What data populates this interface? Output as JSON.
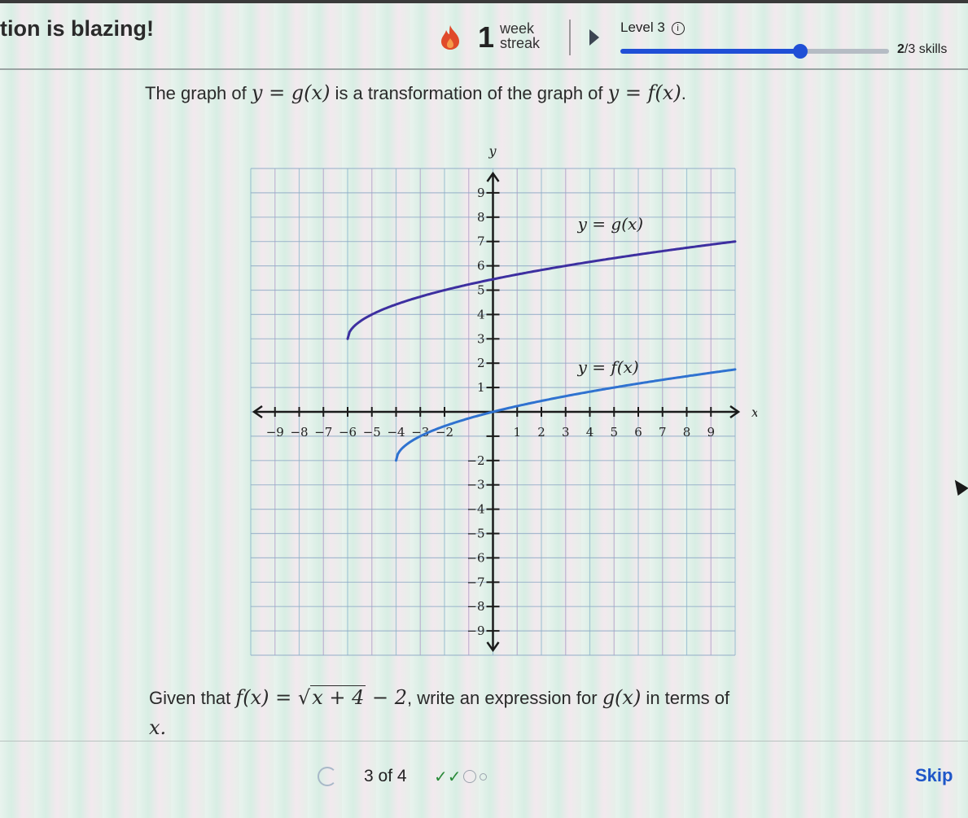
{
  "header": {
    "title_partial": "tion is blazing!",
    "streak": {
      "icon": "flame-icon",
      "count": "1",
      "label_line1": "week",
      "label_line2": "streak"
    },
    "level": {
      "label": "Level 3",
      "info_icon": "info-icon",
      "info_glyph": "i"
    },
    "progress": {
      "fraction": 0.67,
      "skills_done": "2",
      "skills_total_label": "/3 skills"
    },
    "colors": {
      "accent": "#1f4fd6",
      "flame": "#e04a2a",
      "skip": "#1e56c8"
    }
  },
  "prompt": {
    "text1": "The graph of ",
    "math1": "y = g(x)",
    "text2": " is a transformation of the graph of ",
    "math2": "y = f(x)",
    "text3": "."
  },
  "chart_data": {
    "type": "line",
    "xlabel": "x",
    "ylabel": "y",
    "xlim": [
      -10,
      10
    ],
    "ylim": [
      -10,
      10
    ],
    "grid": true,
    "x_ticks": [
      -9,
      -8,
      -7,
      -6,
      -5,
      -4,
      -3,
      -2,
      1,
      2,
      3,
      4,
      5,
      6,
      7,
      8,
      9
    ],
    "y_ticks": [
      -9,
      -8,
      -7,
      -6,
      -5,
      -4,
      -3,
      -2,
      1,
      2,
      3,
      4,
      5,
      6,
      7,
      8,
      9
    ],
    "x_tick_labels": [
      "−9",
      "−8",
      "−7",
      "−6",
      "−5",
      "−4",
      "−3",
      "−2",
      "1",
      "2",
      "3",
      "4",
      "5",
      "6",
      "7",
      "8",
      "9"
    ],
    "y_tick_labels": [
      "−9",
      "−8",
      "−7",
      "−6",
      "−5",
      "−4",
      "−3",
      "−2",
      "1",
      "2",
      "3",
      "4",
      "5",
      "6",
      "7",
      "8",
      "9"
    ],
    "series": [
      {
        "name": "y = g(x)",
        "label_anchor": [
          3.5,
          7.5
        ],
        "color": "#3d2fa0",
        "start": [
          -6,
          3
        ],
        "points": [
          [
            -6,
            3
          ],
          [
            -5,
            4
          ],
          [
            -2,
            5
          ],
          [
            0,
            5.45
          ],
          [
            3,
            6
          ],
          [
            10,
            7
          ]
        ]
      },
      {
        "name": "y = f(x)",
        "label_anchor": [
          3.5,
          1.6
        ],
        "color": "#2f72d0",
        "start": [
          -4,
          -2
        ],
        "points": [
          [
            -4,
            -2
          ],
          [
            -3,
            -1
          ],
          [
            0,
            0
          ],
          [
            5,
            1
          ],
          [
            10,
            1.74
          ]
        ]
      }
    ]
  },
  "question": {
    "text1": "Given that ",
    "math_f": "f(x) = ",
    "radicand": "x + 4",
    "math_tail": " − 2",
    "text2": ", write an expression for ",
    "math_g": "g(x)",
    "text3": " in terms of",
    "line2_math": "x."
  },
  "footer": {
    "refresh_icon": "refresh-icon",
    "count": "3 of 4",
    "checks": "✓✓",
    "skip_label": "Skip"
  }
}
